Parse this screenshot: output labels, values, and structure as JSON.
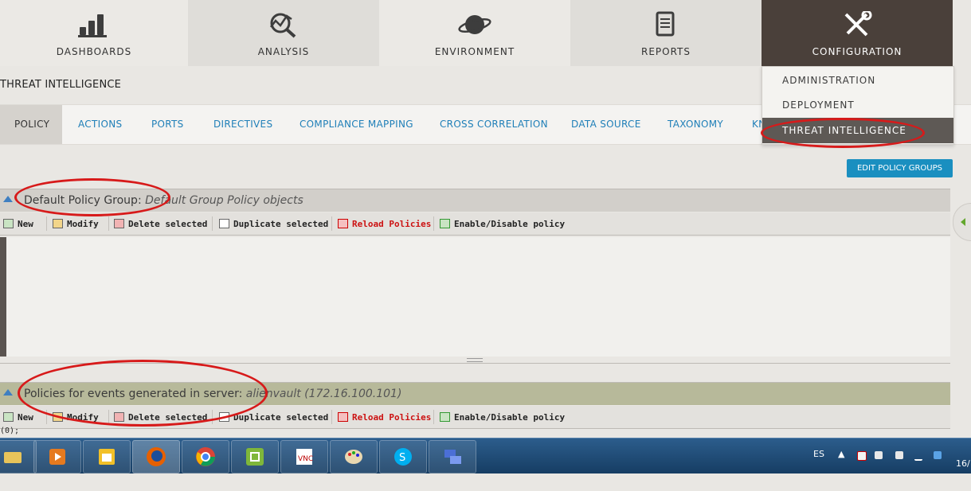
{
  "nav": {
    "dashboards": "DASHBOARDS",
    "analysis": "ANALYSIS",
    "environment": "ENVIRONMENT",
    "reports": "REPORTS",
    "configuration": "CONFIGURATION"
  },
  "dropdown": {
    "administration": "ADMINISTRATION",
    "deployment": "DEPLOYMENT",
    "threat_intelligence": "THREAT INTELLIGENCE"
  },
  "page_title": "THREAT INTELLIGENCE",
  "tabs": {
    "policy": "POLICY",
    "actions": "ACTIONS",
    "ports": "PORTS",
    "directives": "DIRECTIVES",
    "compliance_mapping": "COMPLIANCE MAPPING",
    "cross_correlation": "CROSS CORRELATION",
    "data_source": "DATA SOURCE",
    "taxonomy": "TAXONOMY",
    "truncated": "KN"
  },
  "edit_policy_groups": "EDIT POLICY GROUPS",
  "group1": {
    "title": "Default Policy Group:",
    "subtitle": "Default Group Policy objects"
  },
  "group2": {
    "title": "Policies for events generated in server:",
    "subtitle": "alienvault (172.16.100.101)"
  },
  "toolbar": {
    "new": "New",
    "modify": "Modify",
    "delete": "Delete selected",
    "duplicate": "Duplicate selected",
    "reload": "Reload Policies",
    "enable": "Enable/Disable policy"
  },
  "zero_label": "(0);",
  "tray": {
    "lang": "ES",
    "clock": "16/"
  },
  "colors": {
    "nav_active": "#4a403a",
    "link_blue": "#1f7fb8",
    "button_blue": "#1a8fc0",
    "reload_red": "#cc1111",
    "annotation_red": "#d71a1a",
    "group2_header": "#b7b99a"
  },
  "icons": [
    "bar-chart-icon",
    "magnifier-chart-icon",
    "planet-icon",
    "document-icon",
    "tools-icon"
  ]
}
